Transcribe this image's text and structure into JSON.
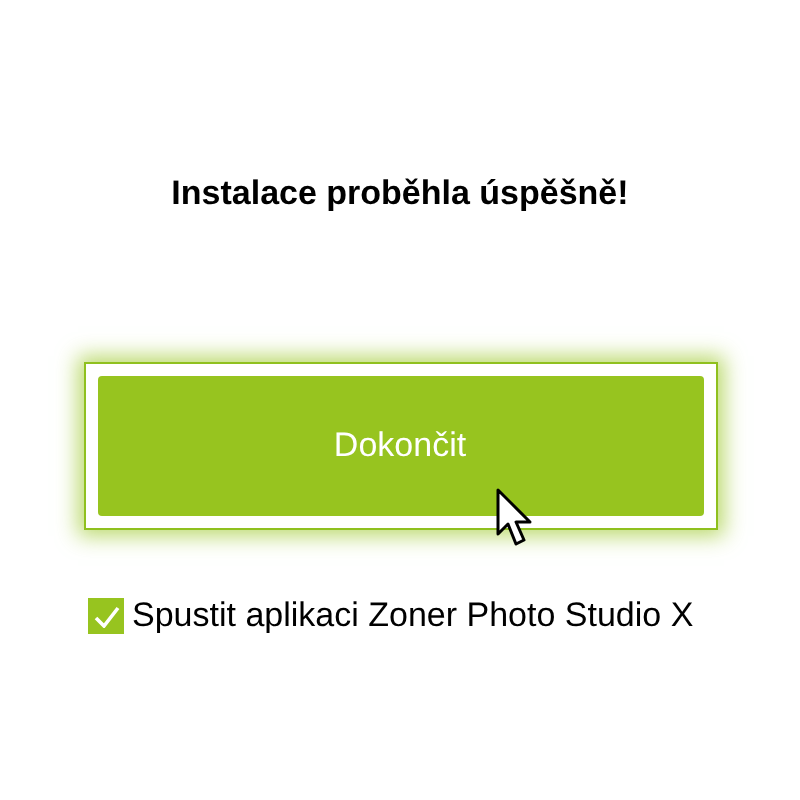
{
  "heading": "Instalace proběhla úspěšně!",
  "finish_button": {
    "label": "Dokončit"
  },
  "launch_option": {
    "label": "Spustit aplikaci Zoner Photo Studio X",
    "checked": true
  }
}
